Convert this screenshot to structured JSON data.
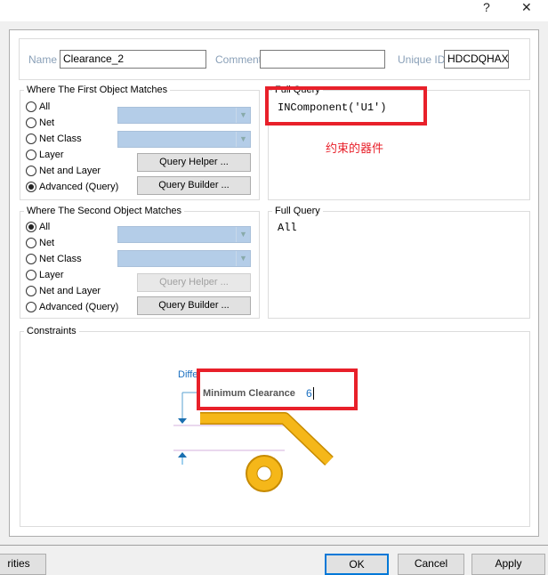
{
  "titlebar": {
    "help": "?",
    "close": "✕"
  },
  "header": {
    "name_label": "Name",
    "name_value": "Clearance_2",
    "comment_label": "Comment",
    "comment_value": "",
    "uid_label": "Unique ID",
    "uid_value": "HDCDQHAX"
  },
  "first": {
    "title": "Where The First Object Matches",
    "options": [
      "All",
      "Net",
      "Net Class",
      "Layer",
      "Net and Layer",
      "Advanced (Query)"
    ],
    "selected": 5,
    "helper": "Query Helper ...",
    "builder": "Query Builder ...",
    "query_title": "Full Query",
    "query": "INComponent('U1')",
    "annotation": "约束的器件"
  },
  "second": {
    "title": "Where The Second Object Matches",
    "options": [
      "All",
      "Net",
      "Net Class",
      "Layer",
      "Net and Layer",
      "Advanced (Query)"
    ],
    "selected": 0,
    "helper": "Query Helper ...",
    "builder": "Query Builder ...",
    "query_title": "Full Query",
    "query": "All"
  },
  "constraints": {
    "title": "Constraints",
    "different_nets": "Different Nets Only",
    "min_clearance_label": "Minimum Clearance",
    "min_clearance_value": "6"
  },
  "footer": {
    "left": "rities",
    "ok": "OK",
    "cancel": "Cancel",
    "apply": "Apply"
  },
  "colors": {
    "highlight": "#e8202a",
    "track": "#f5b719",
    "combo": "#b4cde8"
  }
}
